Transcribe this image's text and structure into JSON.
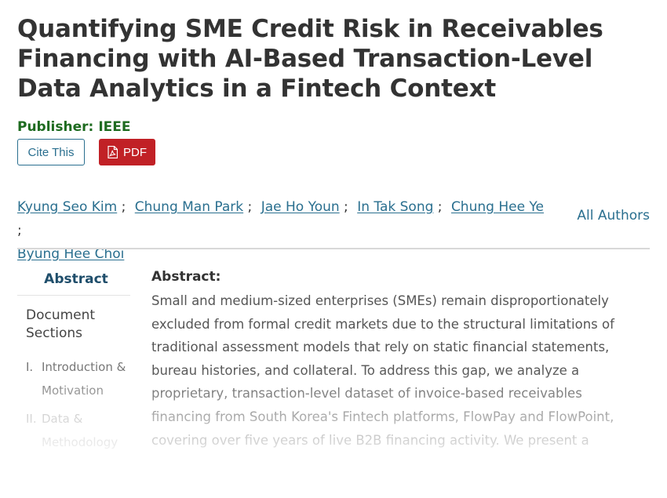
{
  "title": "Quantifying SME Credit Risk in Receivables Financing with AI-Based Transaction-Level Data Analytics in a Fintech Context",
  "publisher": {
    "label": "Publisher:",
    "value": "IEEE"
  },
  "actions": {
    "cite_label": "Cite This",
    "pdf_label": "PDF"
  },
  "authors": [
    "Kyung Seo Kim",
    "Chung Man Park",
    "Jae Ho Youn",
    "In Tak Song",
    "Chung Hee Ye",
    "Byung Hee Choi"
  ],
  "all_authors_label": "All Authors",
  "sidebar": {
    "abstract_label": "Abstract",
    "doc_sections_label": "Document Sections",
    "sections": [
      {
        "num": "I.",
        "label": "Introduction & Motivation"
      },
      {
        "num": "II.",
        "label": "Data & Methodology"
      }
    ]
  },
  "abstract": {
    "heading": "Abstract:",
    "text": "Small and medium-sized enterprises (SMEs) remain disproportionately excluded from formal credit markets due to the structural limitations of traditional assessment models that rely on static financial statements, bureau histories, and collateral. To address this gap, we analyze a proprietary, transaction-level dataset of invoice-based receivables financing from South Korea's Fintech platforms, FlowPay and FlowPoint, covering over five years of live B2B financing activity. We present a"
  },
  "colors": {
    "title": "#333333",
    "publisher": "#1e6b20",
    "link": "#2a6f8f",
    "pdf_button": "#c12126",
    "sidebar_abstract": "#1f4e6b"
  }
}
